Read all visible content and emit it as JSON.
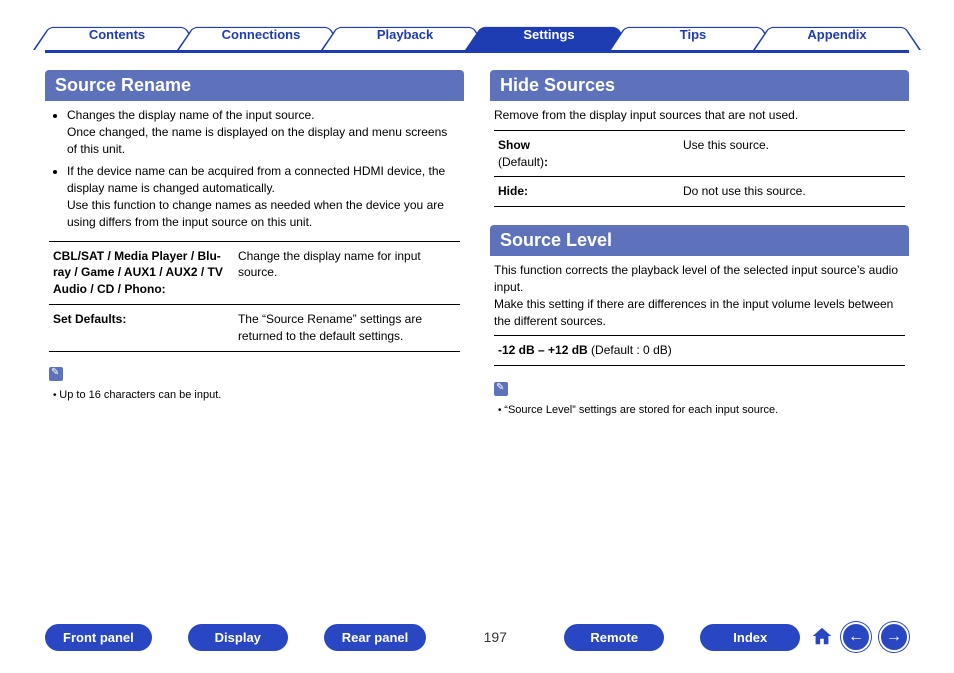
{
  "tabs": [
    "Contents",
    "Connections",
    "Playback",
    "Settings",
    "Tips",
    "Appendix"
  ],
  "activeTab": "Settings",
  "left": {
    "title": "Source Rename",
    "bullets": [
      {
        "main": "Changes the display name of the input source.",
        "sub": "Once changed, the name is displayed on the display and menu screens of this unit."
      },
      {
        "main": "If the device name can be acquired from a connected HDMI device, the display name is changed automatically.",
        "sub": "Use this function to change names as needed when the device you are using differs from the input source on this unit."
      }
    ],
    "rows": [
      {
        "keyBold": "CBL/SAT / Media Player / Blu-ray / Game / AUX1 / AUX2 / TV Audio / CD / Phono:",
        "val": "Change the display name for input source."
      },
      {
        "keyBold": "Set Defaults:",
        "val": "The “Source Rename” settings are returned to the default settings."
      }
    ],
    "note": "Up to 16 characters can be input."
  },
  "rightTop": {
    "title": "Hide Sources",
    "intro": "Remove from the display input sources that are not used.",
    "rows": [
      {
        "keyBold": "Show",
        "keyPlain": "(Default)",
        "keyColon": ":",
        "val": "Use this source."
      },
      {
        "keyBold": "Hide:",
        "val": "Do not use this source."
      }
    ]
  },
  "rightBottom": {
    "title": "Source Level",
    "intro1": "This function corrects the playback level of the selected input source’s audio input.",
    "intro2": "Make this setting if there are differences in the input volume levels between the different sources.",
    "rangeBold": "-12 dB – +12 dB",
    "rangePlain": " (Default : 0 dB)",
    "note": "“Source Level” settings are stored for each input source."
  },
  "bottom": {
    "buttons": [
      "Front panel",
      "Display",
      "Rear panel"
    ],
    "page": "197",
    "buttons2": [
      "Remote",
      "Index"
    ]
  }
}
